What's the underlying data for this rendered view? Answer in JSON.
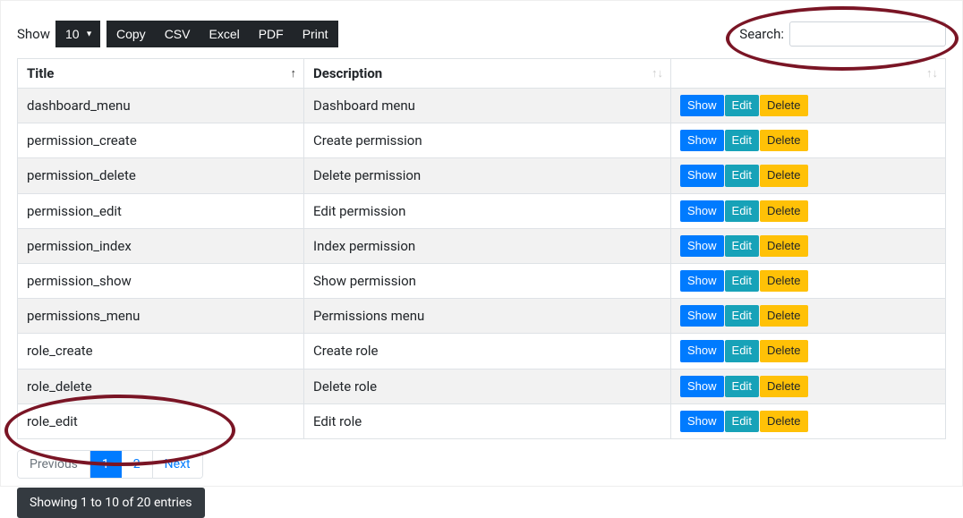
{
  "controls": {
    "show_label": "Show",
    "length_value": "10",
    "export": {
      "copy": "Copy",
      "csv": "CSV",
      "excel": "Excel",
      "pdf": "PDF",
      "print": "Print"
    },
    "search_label": "Search:",
    "search_value": ""
  },
  "table": {
    "headers": {
      "title": "Title",
      "description": "Description"
    },
    "actions": {
      "show": "Show",
      "edit": "Edit",
      "delete": "Delete"
    },
    "rows": [
      {
        "title": "dashboard_menu",
        "description": "Dashboard menu"
      },
      {
        "title": "permission_create",
        "description": "Create permission"
      },
      {
        "title": "permission_delete",
        "description": "Delete permission"
      },
      {
        "title": "permission_edit",
        "description": "Edit permission"
      },
      {
        "title": "permission_index",
        "description": "Index permission"
      },
      {
        "title": "permission_show",
        "description": "Show permission"
      },
      {
        "title": "permissions_menu",
        "description": "Permissions menu"
      },
      {
        "title": "role_create",
        "description": "Create role"
      },
      {
        "title": "role_delete",
        "description": "Delete role"
      },
      {
        "title": "role_edit",
        "description": "Edit role"
      }
    ]
  },
  "pagination": {
    "previous": "Previous",
    "page1": "1",
    "page2": "2",
    "next": "Next"
  },
  "info": "Showing 1 to 10 of 20 entries"
}
